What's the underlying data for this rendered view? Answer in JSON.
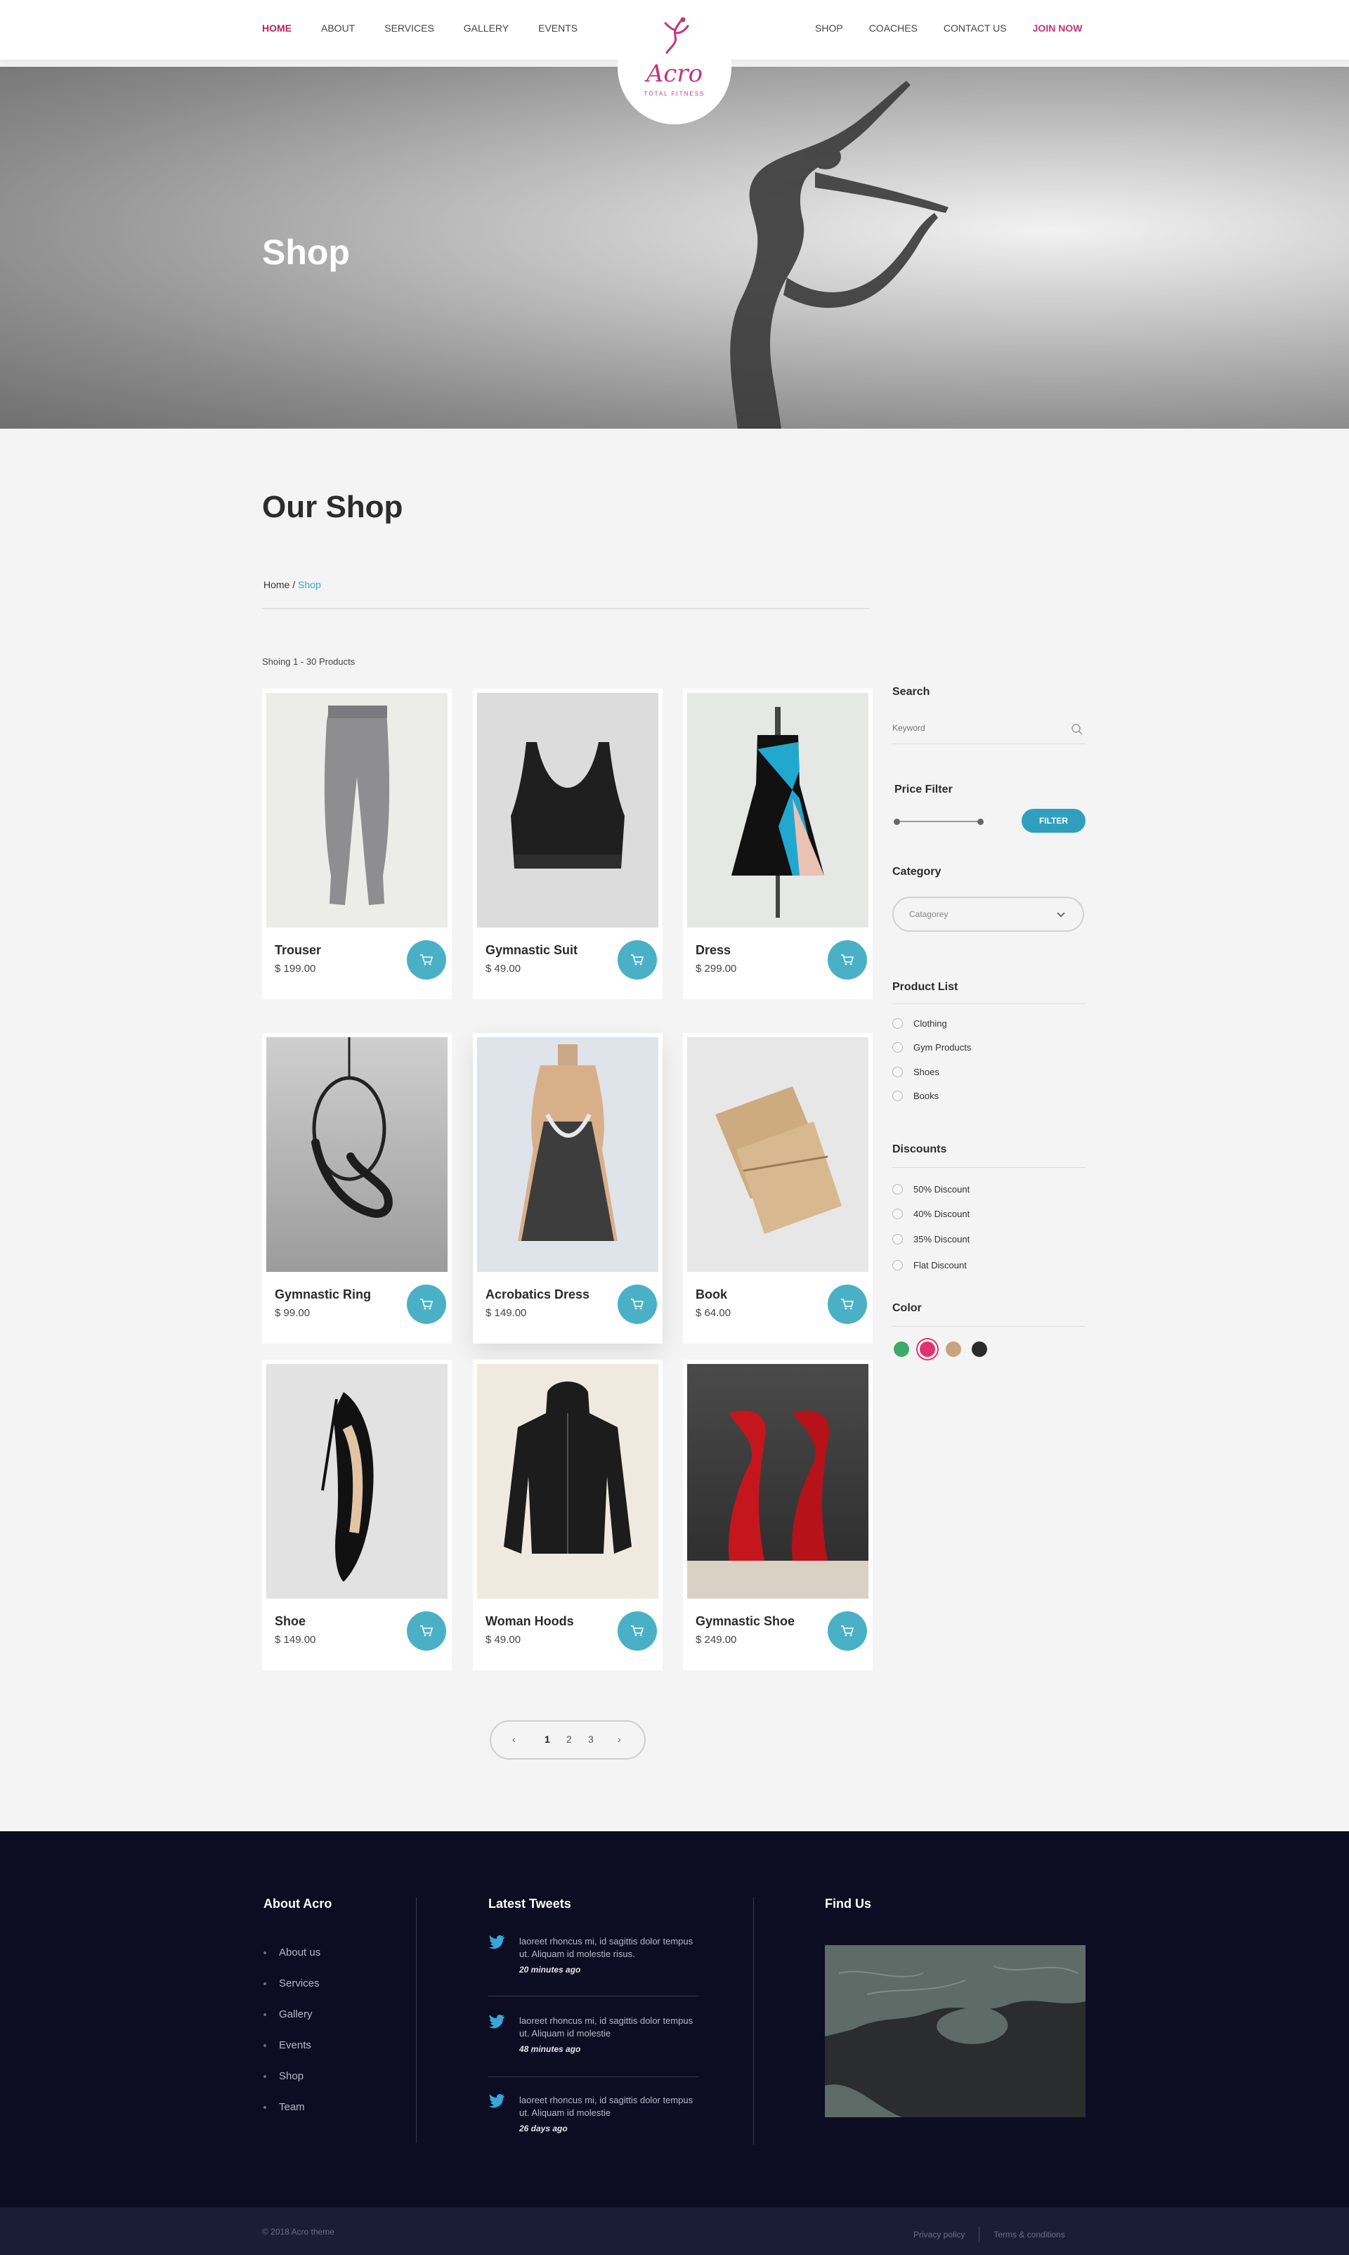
{
  "header": {
    "nav_left": [
      "HOME",
      "ABOUT",
      "SERVICES",
      "GALLERY",
      "EVENTS"
    ],
    "nav_right": [
      "SHOP",
      "COACHES",
      "CONTACT US",
      "JOIN NOW"
    ],
    "logo": {
      "name": "Acro",
      "tagline": "TOTAL FITNESS"
    }
  },
  "hero": {
    "title": "Shop"
  },
  "main": {
    "title": "Our Shop",
    "breadcrumb": {
      "home": "Home",
      "separator": " / ",
      "current": "Shop"
    },
    "showing": "Shoing 1 - 30 Products"
  },
  "products": [
    {
      "name": "Trouser",
      "price": "$ 199.00",
      "icon": "trouser-image"
    },
    {
      "name": "Gymnastic Suit",
      "price": "$ 49.00",
      "icon": "sports-bra-image"
    },
    {
      "name": "Dress",
      "price": "$ 299.00",
      "icon": "dress-image"
    },
    {
      "name": "Gymnastic Ring",
      "price": "$ 99.00",
      "icon": "aerial-ring-image"
    },
    {
      "name": "Acrobatics Dress",
      "price": "$ 149.00",
      "icon": "leotard-image"
    },
    {
      "name": "Book",
      "price": "$ 64.00",
      "icon": "book-image"
    },
    {
      "name": "Shoe",
      "price": "$ 149.00",
      "icon": "heel-shoe-image"
    },
    {
      "name": "Woman Hoods",
      "price": "$ 49.00",
      "icon": "jacket-image"
    },
    {
      "name": "Gymnastic Shoe",
      "price": "$ 249.00",
      "icon": "pointe-shoe-image"
    }
  ],
  "pagination": {
    "pages": [
      "1",
      "2",
      "3"
    ],
    "current": "1"
  },
  "sidebar": {
    "search": {
      "title": "Search",
      "placeholder": "Keyword"
    },
    "price_filter": {
      "title": "Price Filter",
      "button": "FILTER"
    },
    "category": {
      "title": "Category",
      "placeholder": "Catagorey"
    },
    "product_list": {
      "title": "Product List",
      "items": [
        "Clothing",
        "Gym Products",
        "Shoes",
        "Books"
      ]
    },
    "discounts": {
      "title": "Discounts",
      "items": [
        "50% Discount",
        "40% Discount",
        "35% Discount",
        "Flat Discount"
      ]
    },
    "color": {
      "title": "Color",
      "swatches": [
        "#3daa6a",
        "#e0336f",
        "#c8a47e",
        "#2b2b2b"
      ],
      "selected": "#e0336f"
    }
  },
  "footer": {
    "about": {
      "title": "About Acro",
      "links": [
        "About us",
        "Services",
        "Gallery",
        "Events",
        "Shop",
        "Team"
      ]
    },
    "tweets": {
      "title": "Latest Tweets",
      "items": [
        {
          "text": "laoreet rhoncus mi, id sagittis dolor tempus ut. Aliquam id molestie risus.",
          "time": "20 minutes ago"
        },
        {
          "text": "laoreet rhoncus mi, id sagittis dolor tempus ut. Aliquam id molestie",
          "time": "48 minutes ago"
        },
        {
          "text": "laoreet rhoncus mi, id sagittis dolor tempus ut. Aliquam id molestie",
          "time": "26 days ago"
        }
      ]
    },
    "find_us": {
      "title": "Find Us"
    },
    "copyright": "© 2018 Acro theme",
    "bottom_links": [
      "Privacy policy",
      "Terms & conditions"
    ]
  },
  "colors": {
    "accent": "#c2367a",
    "cart": "#4ab0c6",
    "filter": "#2f9fbd",
    "footer_bg": "#0c0c22",
    "link": "#3aa5c4"
  }
}
